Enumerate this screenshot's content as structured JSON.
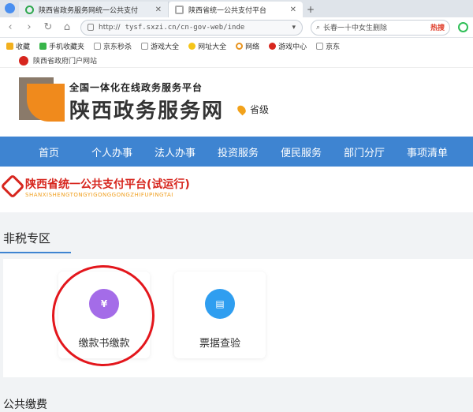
{
  "browser": {
    "tabs": [
      {
        "title": "陕西省政务服务网统一公共支付",
        "active": false
      },
      {
        "title": "陕西省统一公共支付平台",
        "active": true
      }
    ],
    "new_tab": "+",
    "address": {
      "scheme": "http://",
      "url": "tysf.sxzi.cn/cn-gov-web/inde"
    },
    "search_placeholder": "长春一十中女生删除",
    "search_hot": "热搜",
    "bookmarks": [
      "收藏",
      "手机收藏夹",
      "京东秒杀",
      "游戏大全",
      "网址大全",
      "网络",
      "游戏中心",
      "京东"
    ],
    "page_strip_label": "陕西省政府门户网站"
  },
  "header": {
    "subtitle": "全国一体化在线政务服务平台",
    "title": "陕西政务服务网",
    "location": "省级"
  },
  "nav": [
    "首页",
    "个人办事",
    "法人办事",
    "投资服务",
    "便民服务",
    "部门分厅",
    "事项清单"
  ],
  "platform": {
    "title": "陕西省统一公共支付平台(试运行)",
    "pinyin": "SHANXISHENGTONGYIGONGGONGZHIFUPINGTAI"
  },
  "section": {
    "title": "非税专区",
    "cards": [
      {
        "label": "缴款书缴款",
        "icon": "yuan-icon",
        "glyph": "¥",
        "color": "#a46ce8"
      },
      {
        "label": "票据查验",
        "icon": "receipt-icon",
        "glyph": "▤",
        "color": "#2f9ef0"
      }
    ]
  },
  "section2": {
    "title": "公共缴费"
  }
}
